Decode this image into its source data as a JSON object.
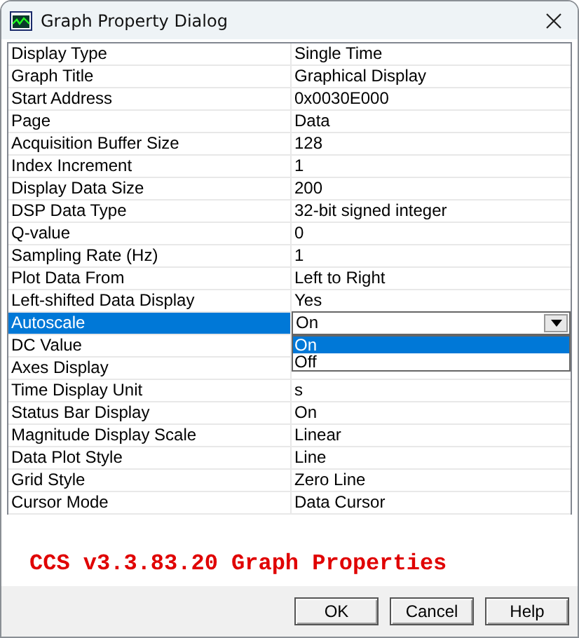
{
  "window": {
    "title": "Graph Property Dialog"
  },
  "properties": [
    {
      "name": "Display Type",
      "value": "Single Time",
      "selected": false
    },
    {
      "name": "Graph Title",
      "value": "Graphical Display",
      "selected": false
    },
    {
      "name": "Start Address",
      "value": "0x0030E000",
      "selected": false
    },
    {
      "name": "Page",
      "value": "Data",
      "selected": false
    },
    {
      "name": "Acquisition Buffer Size",
      "value": "128",
      "selected": false
    },
    {
      "name": "Index Increment",
      "value": "1",
      "selected": false
    },
    {
      "name": "Display Data Size",
      "value": "200",
      "selected": false
    },
    {
      "name": "DSP Data Type",
      "value": "32-bit signed integer",
      "selected": false
    },
    {
      "name": "Q-value",
      "value": "0",
      "selected": false
    },
    {
      "name": "Sampling Rate (Hz)",
      "value": "1",
      "selected": false
    },
    {
      "name": "Plot Data From",
      "value": "Left to Right",
      "selected": false
    },
    {
      "name": "Left-shifted Data Display",
      "value": "Yes",
      "selected": false
    },
    {
      "name": "Autoscale",
      "value": "On",
      "selected": true,
      "kind": "combo",
      "options": [
        {
          "label": "On",
          "selected": true
        },
        {
          "label": "Off",
          "selected": false
        }
      ]
    },
    {
      "name": "DC Value",
      "selected": false
    },
    {
      "name": "Axes Display",
      "selected": false
    },
    {
      "name": "Time Display Unit",
      "value": "s",
      "selected": false
    },
    {
      "name": "Status Bar Display",
      "value": "On",
      "selected": false
    },
    {
      "name": "Magnitude Display Scale",
      "value": "Linear",
      "selected": false
    },
    {
      "name": "Data Plot Style",
      "value": "Line",
      "selected": false
    },
    {
      "name": "Grid Style",
      "value": "Zero Line",
      "selected": false
    },
    {
      "name": "Cursor Mode",
      "value": "Data Cursor",
      "selected": false
    }
  ],
  "caption": "CCS v3.3.83.20 Graph Properties",
  "buttons": [
    "OK",
    "Cancel",
    "Help"
  ]
}
